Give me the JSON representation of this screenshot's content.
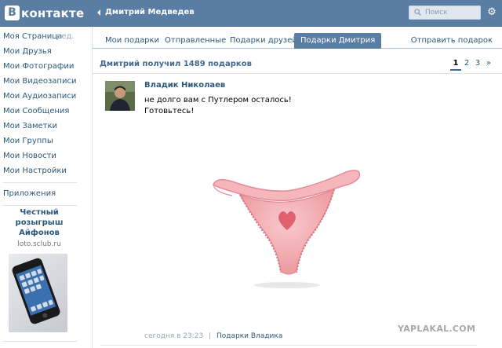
{
  "header": {
    "logo_letter": "В",
    "logo_text": "контакте",
    "back_title": "Дмитрий Медведев",
    "search_placeholder": "Поиск",
    "brand_color": "#597da3",
    "settings_icon": "gear-icon"
  },
  "sidebar": {
    "items": [
      {
        "label": "Моя Страница",
        "edit": "ред."
      },
      {
        "label": "Мои Друзья"
      },
      {
        "label": "Мои Фотографии"
      },
      {
        "label": "Мои Видеозаписи"
      },
      {
        "label": "Мои Аудиозаписи"
      },
      {
        "label": "Мои Сообщения"
      },
      {
        "label": "Мои Заметки"
      },
      {
        "label": "Мои Группы"
      },
      {
        "label": "Мои Новости"
      },
      {
        "label": "Мои Настройки"
      }
    ],
    "apps": "Приложения",
    "ad": {
      "title": "Честный розыгрыш Айфонов",
      "url": "loto.sclub.ru"
    }
  },
  "tabs": [
    {
      "label": "Мои подарки",
      "active": false
    },
    {
      "label": "Отправленные",
      "active": false
    },
    {
      "label": "Подарки друзей",
      "active": false
    },
    {
      "label": "Подарки Дмитрия",
      "active": true
    }
  ],
  "send_gift": "Отправить подарок",
  "summary": "Дмитрий получил 1489 подарков",
  "pager": {
    "pages": [
      "1",
      "2",
      "3",
      "»"
    ],
    "current": "1"
  },
  "gift": {
    "sender": "Владик Николаев",
    "message_line1": "не долго вам с Путлером осталось!",
    "message_line2": "Готовьтесь!",
    "time": "сегодня в 23:23",
    "separator": "|",
    "link": "Подарки Владика"
  },
  "watermark": "YAPLAKAL.COM"
}
